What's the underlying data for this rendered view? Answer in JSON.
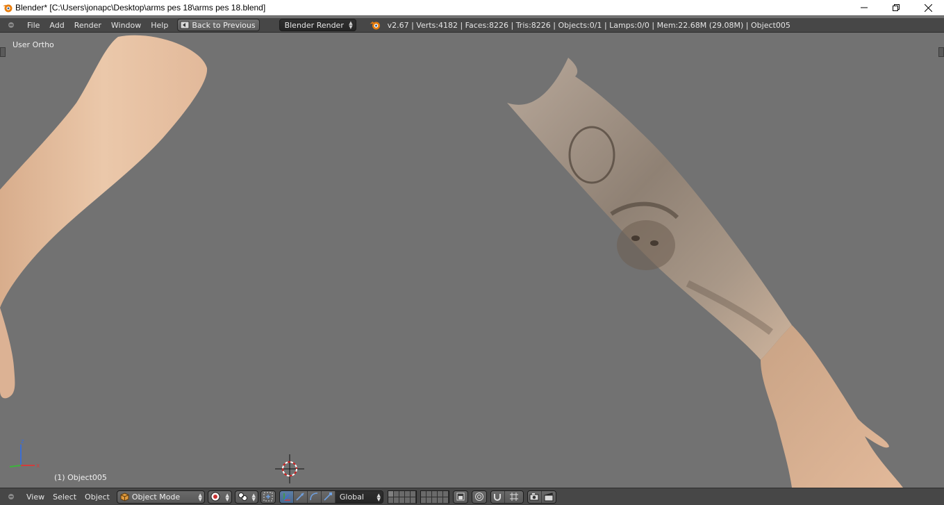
{
  "window": {
    "title": "Blender* [C:\\Users\\jonapc\\Desktop\\arms pes 18\\arms pes 18.blend]",
    "icons": [
      "blender-icon",
      "minimize-icon",
      "maximize-icon",
      "close-icon"
    ]
  },
  "info_header": {
    "menus": [
      "File",
      "Add",
      "Render",
      "Window",
      "Help"
    ],
    "back_button": "Back to Previous",
    "render_engine": "Blender Render",
    "stats": "v2.67 | Verts:4182 | Faces:8226 | Tris:8226 | Objects:0/1 | Lamps:0/0 | Mem:22.68M (29.08M) | Object005"
  },
  "viewport": {
    "view_label": "User Ortho",
    "object_label": "(1) Object005",
    "background_color": "#727272",
    "axis_labels": {
      "x": "x",
      "z": "z"
    },
    "axis_colors": {
      "x": "#d23c3c",
      "y": "#3cb43c",
      "z": "#3c6ed2"
    }
  },
  "view3d_header": {
    "menus": [
      "View",
      "Select",
      "Object"
    ],
    "mode": "Object Mode",
    "transform_orientation": "Global"
  },
  "colors": {
    "header_bg": "#474747",
    "active_button": "#5d7fa6",
    "skin": "#e8c3a4",
    "tattoo_skin": "#cdb39c"
  }
}
